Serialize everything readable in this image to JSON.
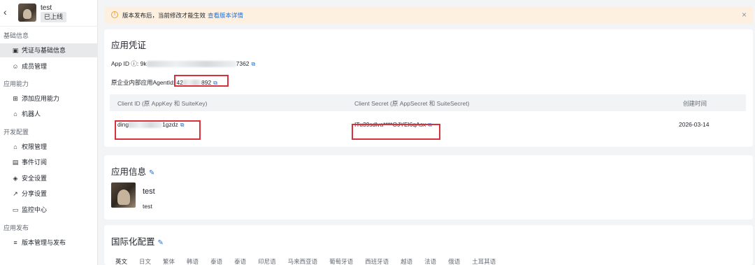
{
  "app": {
    "name": "test",
    "status": "已上线"
  },
  "sidebar": {
    "groups": [
      {
        "label": "基础信息",
        "items": [
          {
            "label": "凭证与基础信息",
            "icon": "credential-icon",
            "active": true
          },
          {
            "label": "成员管理",
            "icon": "member-icon"
          }
        ]
      },
      {
        "label": "应用能力",
        "items": [
          {
            "label": "添加应用能力",
            "icon": "grid-add-icon"
          },
          {
            "label": "机器人",
            "icon": "robot-icon"
          }
        ]
      },
      {
        "label": "开发配置",
        "items": [
          {
            "label": "权限管理",
            "icon": "lock-icon"
          },
          {
            "label": "事件订阅",
            "icon": "event-icon"
          },
          {
            "label": "安全设置",
            "icon": "shield-icon"
          },
          {
            "label": "分享设置",
            "icon": "share-icon"
          },
          {
            "label": "监控中心",
            "icon": "monitor-icon"
          }
        ]
      },
      {
        "label": "应用发布",
        "items": [
          {
            "label": "版本管理与发布",
            "icon": "layers-icon"
          }
        ]
      }
    ]
  },
  "banner": {
    "message": "版本发布后，当前修改才能生效",
    "link": "查看版本详情"
  },
  "credentials": {
    "title": "应用凭证",
    "app_id_label": "App ID",
    "app_id_prefix": "9k",
    "app_id_suffix": "7362",
    "agent_id_label": "原企业内部应用AgentId:",
    "agent_id_prefix": "42",
    "agent_id_suffix": "892",
    "table": {
      "headers": [
        "Client ID (原 AppKey 和 SuiteKey)",
        "Client Secret (原 AppSecret 和 SuiteSecret)",
        "创建时间"
      ],
      "client_id_prefix": "ding",
      "client_id_suffix": "1gzdz",
      "client_secret": "ITu39sdlva****OJYEl6qAsx",
      "created": "2026-03-14"
    }
  },
  "app_info": {
    "title": "应用信息",
    "name": "test",
    "description": "test"
  },
  "i18n": {
    "title": "国际化配置",
    "languages": [
      "英文",
      "日文",
      "繁体",
      "韩语",
      "泰语",
      "泰语",
      "印尼语",
      "马来西亚语",
      "葡萄牙语",
      "西班牙语",
      "越语",
      "法语",
      "俄语",
      "土耳其语"
    ]
  },
  "colors": {
    "accent": "#1e6fd9",
    "highlight_box": "#d9303b",
    "banner_bg": "#fdf0e1"
  }
}
